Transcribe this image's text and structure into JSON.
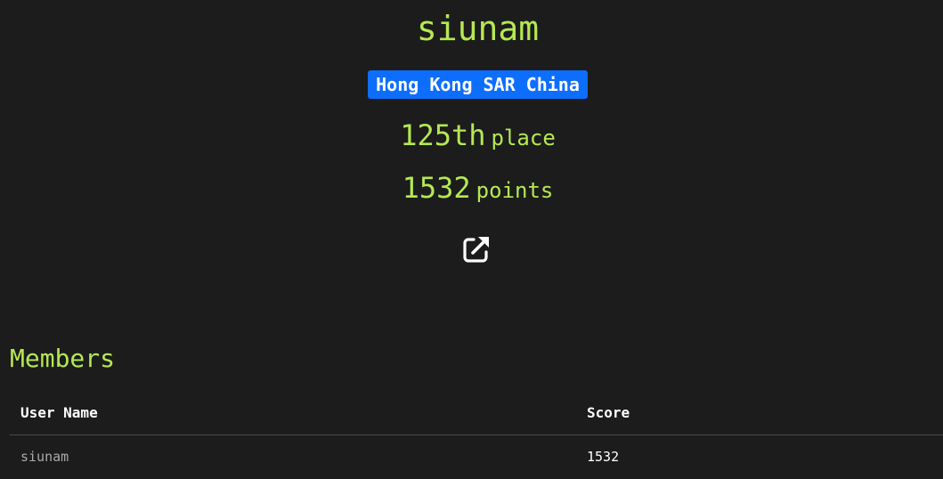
{
  "team": {
    "name": "siunam",
    "country": "Hong Kong SAR China",
    "rank": "125th",
    "rank_suffix": "place",
    "points": "1532",
    "points_suffix": "points",
    "external_link_icon": "external-link-icon"
  },
  "members": {
    "title": "Members",
    "columns": [
      "User Name",
      "Score"
    ],
    "rows": [
      {
        "user": "siunam",
        "score": "1532"
      }
    ]
  },
  "colors": {
    "background": "#1c1c1c",
    "accent": "#b5e853",
    "badge": "#0d6efd"
  }
}
